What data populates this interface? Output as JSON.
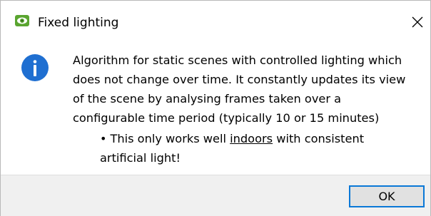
{
  "window": {
    "title": "Fixed lighting",
    "app_icon": "eye-icon",
    "close_icon": "close-icon"
  },
  "message": {
    "icon": "info-icon",
    "text": "Algorithm for static scenes with controlled lighting which does not change over time. It constantly updates its view of the scene by analysing frames taken over a configurable time period (typically 10 or 15 minutes)",
    "bullet": {
      "prefix": "This only works well ",
      "emphasis": "indoors",
      "suffix": " with consistent artificial light!"
    }
  },
  "footer": {
    "ok_label": "OK"
  },
  "colors": {
    "app_icon": "#5aa530",
    "info_icon": "#1f6fd1",
    "ok_border": "#0a78d7",
    "footer_bg": "#f0f0f0"
  }
}
